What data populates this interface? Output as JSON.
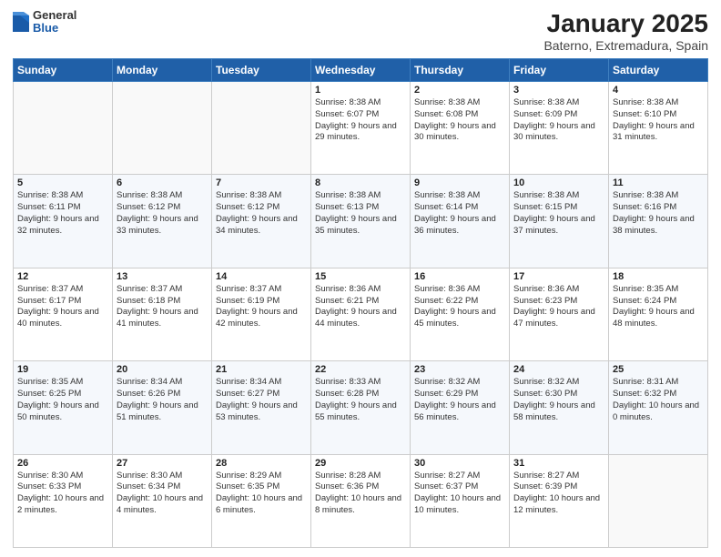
{
  "header": {
    "logo_general": "General",
    "logo_blue": "Blue",
    "title": "January 2025",
    "subtitle": "Baterno, Extremadura, Spain"
  },
  "days_of_week": [
    "Sunday",
    "Monday",
    "Tuesday",
    "Wednesday",
    "Thursday",
    "Friday",
    "Saturday"
  ],
  "weeks": [
    [
      {
        "day": "",
        "content": ""
      },
      {
        "day": "",
        "content": ""
      },
      {
        "day": "",
        "content": ""
      },
      {
        "day": "1",
        "content": "Sunrise: 8:38 AM\nSunset: 6:07 PM\nDaylight: 9 hours and 29 minutes."
      },
      {
        "day": "2",
        "content": "Sunrise: 8:38 AM\nSunset: 6:08 PM\nDaylight: 9 hours and 30 minutes."
      },
      {
        "day": "3",
        "content": "Sunrise: 8:38 AM\nSunset: 6:09 PM\nDaylight: 9 hours and 30 minutes."
      },
      {
        "day": "4",
        "content": "Sunrise: 8:38 AM\nSunset: 6:10 PM\nDaylight: 9 hours and 31 minutes."
      }
    ],
    [
      {
        "day": "5",
        "content": "Sunrise: 8:38 AM\nSunset: 6:11 PM\nDaylight: 9 hours and 32 minutes."
      },
      {
        "day": "6",
        "content": "Sunrise: 8:38 AM\nSunset: 6:12 PM\nDaylight: 9 hours and 33 minutes."
      },
      {
        "day": "7",
        "content": "Sunrise: 8:38 AM\nSunset: 6:12 PM\nDaylight: 9 hours and 34 minutes."
      },
      {
        "day": "8",
        "content": "Sunrise: 8:38 AM\nSunset: 6:13 PM\nDaylight: 9 hours and 35 minutes."
      },
      {
        "day": "9",
        "content": "Sunrise: 8:38 AM\nSunset: 6:14 PM\nDaylight: 9 hours and 36 minutes."
      },
      {
        "day": "10",
        "content": "Sunrise: 8:38 AM\nSunset: 6:15 PM\nDaylight: 9 hours and 37 minutes."
      },
      {
        "day": "11",
        "content": "Sunrise: 8:38 AM\nSunset: 6:16 PM\nDaylight: 9 hours and 38 minutes."
      }
    ],
    [
      {
        "day": "12",
        "content": "Sunrise: 8:37 AM\nSunset: 6:17 PM\nDaylight: 9 hours and 40 minutes."
      },
      {
        "day": "13",
        "content": "Sunrise: 8:37 AM\nSunset: 6:18 PM\nDaylight: 9 hours and 41 minutes."
      },
      {
        "day": "14",
        "content": "Sunrise: 8:37 AM\nSunset: 6:19 PM\nDaylight: 9 hours and 42 minutes."
      },
      {
        "day": "15",
        "content": "Sunrise: 8:36 AM\nSunset: 6:21 PM\nDaylight: 9 hours and 44 minutes."
      },
      {
        "day": "16",
        "content": "Sunrise: 8:36 AM\nSunset: 6:22 PM\nDaylight: 9 hours and 45 minutes."
      },
      {
        "day": "17",
        "content": "Sunrise: 8:36 AM\nSunset: 6:23 PM\nDaylight: 9 hours and 47 minutes."
      },
      {
        "day": "18",
        "content": "Sunrise: 8:35 AM\nSunset: 6:24 PM\nDaylight: 9 hours and 48 minutes."
      }
    ],
    [
      {
        "day": "19",
        "content": "Sunrise: 8:35 AM\nSunset: 6:25 PM\nDaylight: 9 hours and 50 minutes."
      },
      {
        "day": "20",
        "content": "Sunrise: 8:34 AM\nSunset: 6:26 PM\nDaylight: 9 hours and 51 minutes."
      },
      {
        "day": "21",
        "content": "Sunrise: 8:34 AM\nSunset: 6:27 PM\nDaylight: 9 hours and 53 minutes."
      },
      {
        "day": "22",
        "content": "Sunrise: 8:33 AM\nSunset: 6:28 PM\nDaylight: 9 hours and 55 minutes."
      },
      {
        "day": "23",
        "content": "Sunrise: 8:32 AM\nSunset: 6:29 PM\nDaylight: 9 hours and 56 minutes."
      },
      {
        "day": "24",
        "content": "Sunrise: 8:32 AM\nSunset: 6:30 PM\nDaylight: 9 hours and 58 minutes."
      },
      {
        "day": "25",
        "content": "Sunrise: 8:31 AM\nSunset: 6:32 PM\nDaylight: 10 hours and 0 minutes."
      }
    ],
    [
      {
        "day": "26",
        "content": "Sunrise: 8:30 AM\nSunset: 6:33 PM\nDaylight: 10 hours and 2 minutes."
      },
      {
        "day": "27",
        "content": "Sunrise: 8:30 AM\nSunset: 6:34 PM\nDaylight: 10 hours and 4 minutes."
      },
      {
        "day": "28",
        "content": "Sunrise: 8:29 AM\nSunset: 6:35 PM\nDaylight: 10 hours and 6 minutes."
      },
      {
        "day": "29",
        "content": "Sunrise: 8:28 AM\nSunset: 6:36 PM\nDaylight: 10 hours and 8 minutes."
      },
      {
        "day": "30",
        "content": "Sunrise: 8:27 AM\nSunset: 6:37 PM\nDaylight: 10 hours and 10 minutes."
      },
      {
        "day": "31",
        "content": "Sunrise: 8:27 AM\nSunset: 6:39 PM\nDaylight: 10 hours and 12 minutes."
      },
      {
        "day": "",
        "content": ""
      }
    ]
  ]
}
